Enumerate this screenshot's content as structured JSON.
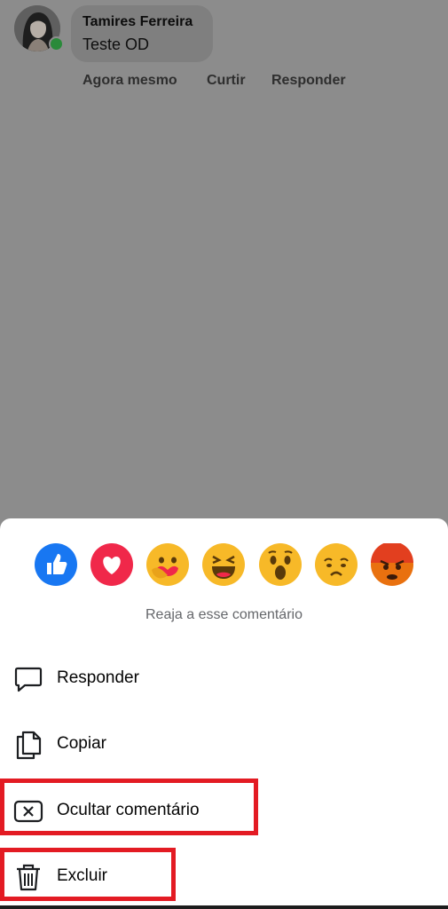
{
  "comment": {
    "author": "Tamires Ferreira",
    "text": "Teste OD",
    "time": "Agora mesmo",
    "like_label": "Curtir",
    "reply_label": "Responder"
  },
  "reactions": {
    "items": [
      "like-icon",
      "love-icon",
      "care-icon",
      "haha-icon",
      "wow-icon",
      "sad-icon",
      "angry-icon"
    ],
    "hint": "Reaja a esse comentário"
  },
  "menu": {
    "reply": "Responder",
    "copy": "Copiar",
    "hide": "Ocultar comentário",
    "delete": "Excluir"
  },
  "colors": {
    "overlay": "#8c8c8c",
    "highlight": "#e31b23",
    "like": "#1877f2",
    "love": "#f0284a",
    "emoji_yellow": "#f7b928",
    "angry": "#e9710f"
  }
}
